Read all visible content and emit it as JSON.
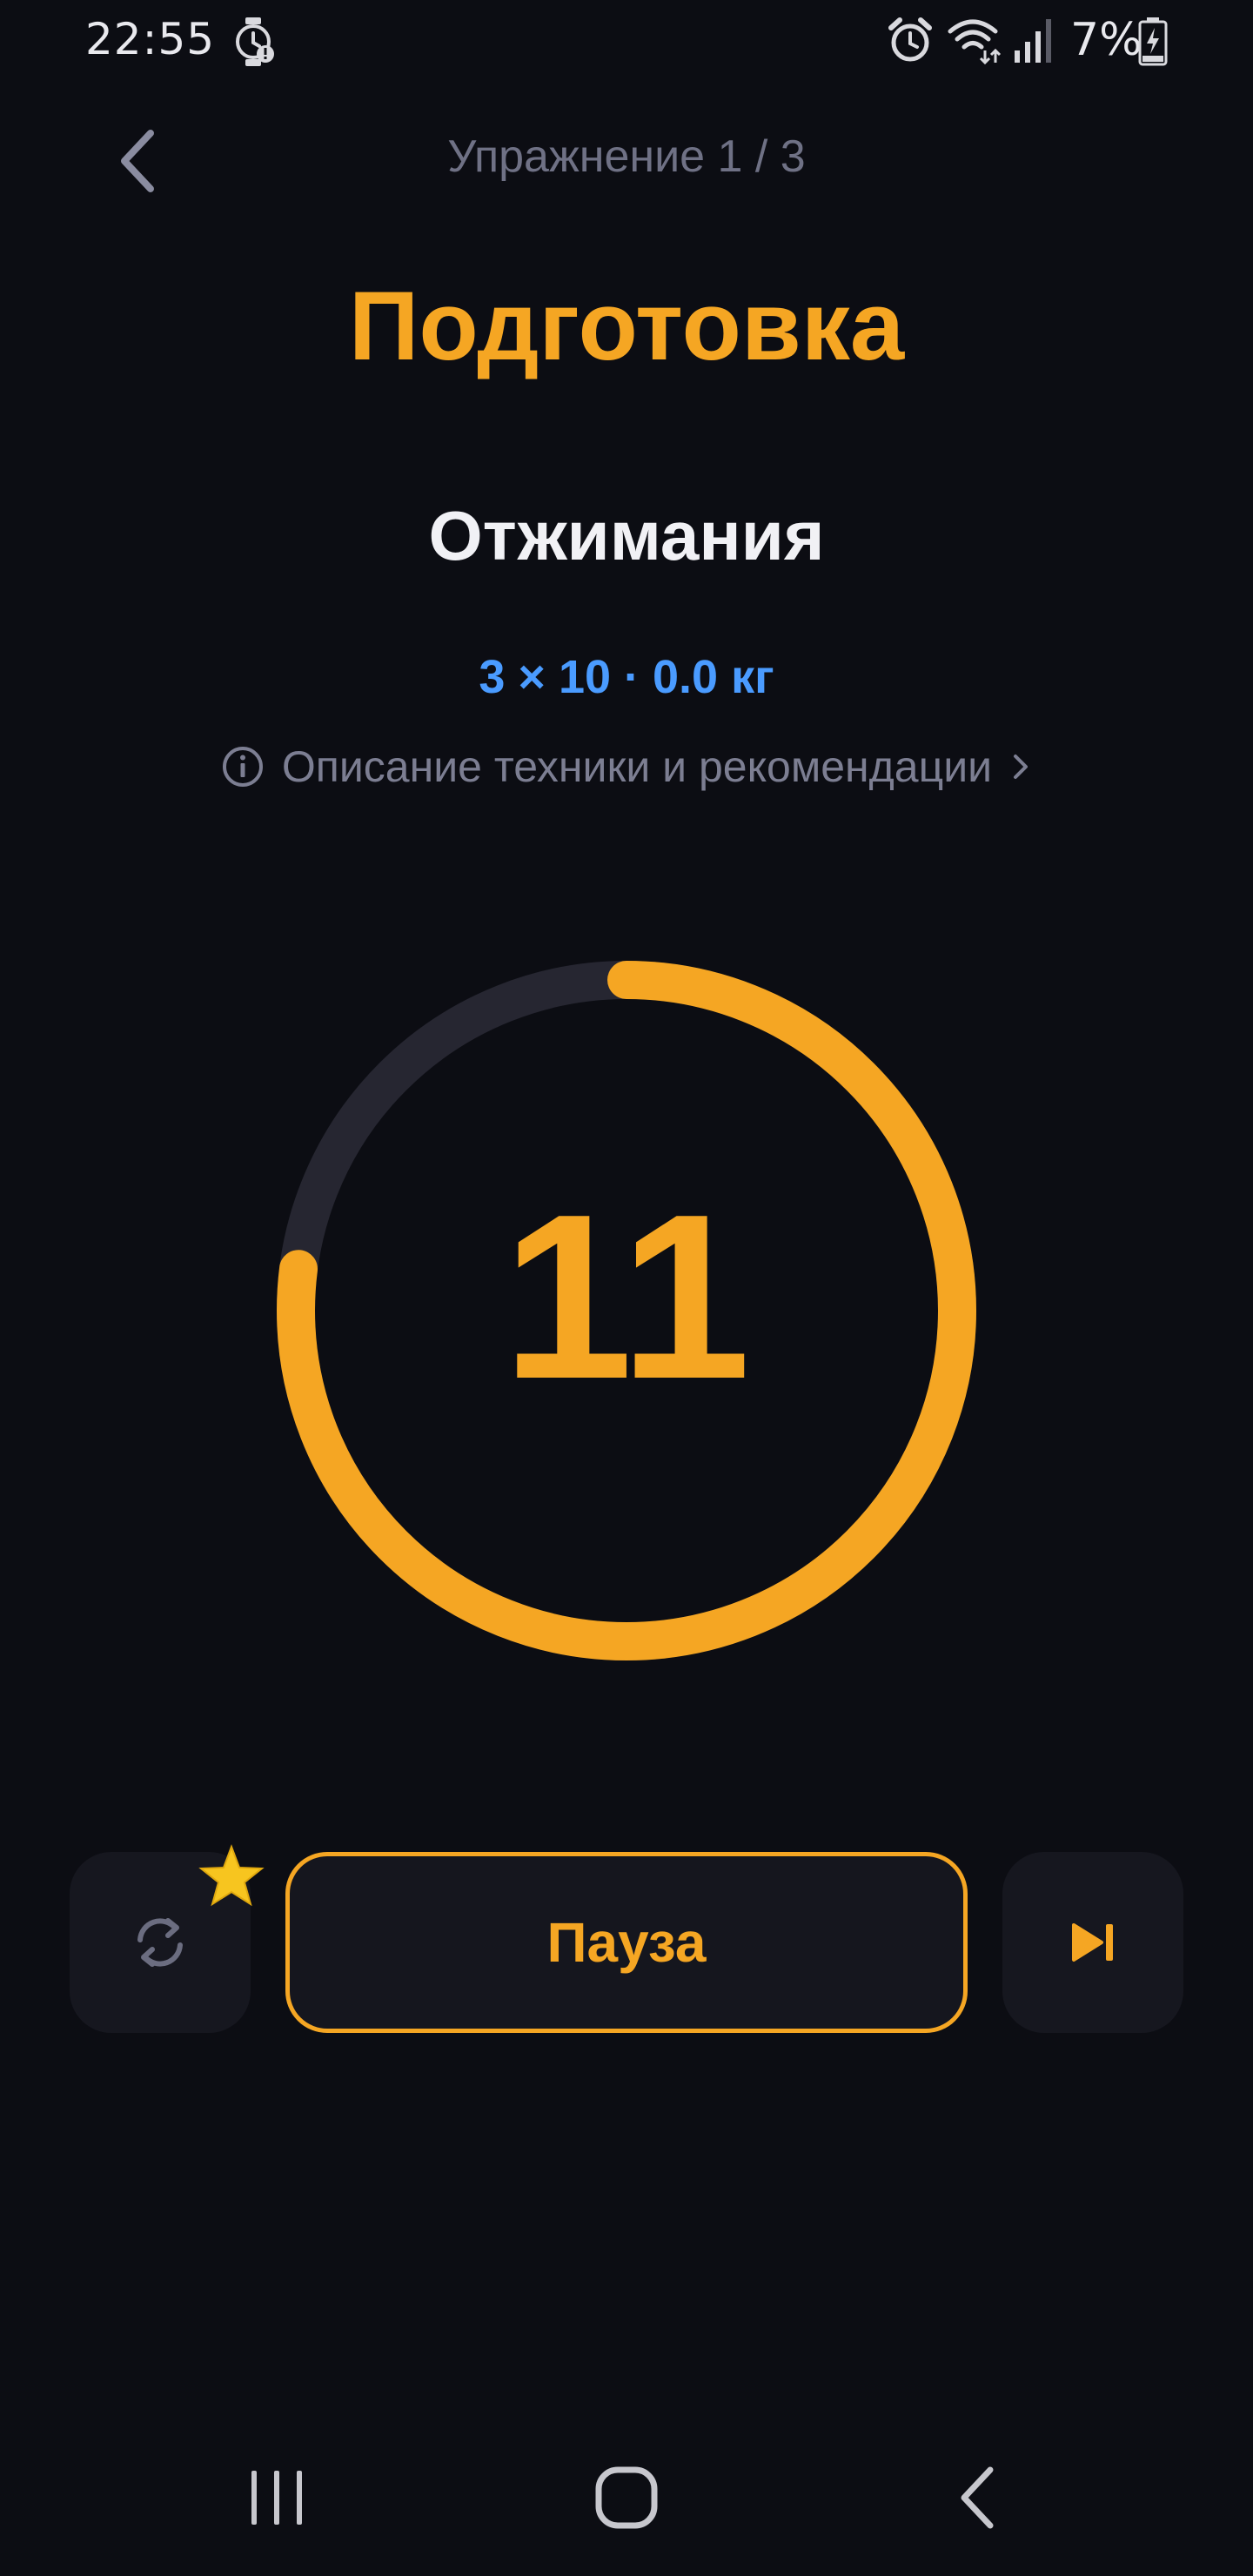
{
  "status_bar": {
    "time": "22:55",
    "battery": "7%",
    "icons": [
      "watch-alert-icon",
      "alarm-icon",
      "wifi-icon",
      "signal-icon",
      "battery-charging-icon"
    ]
  },
  "header": {
    "back_icon": "chevron-left-icon",
    "exercise_counter": "Упражнение 1 / 3"
  },
  "phase": {
    "title": "Подготовка"
  },
  "exercise": {
    "name": "Отжимания",
    "params": "3 × 10 · 0.0 кг",
    "description_link": "Описание техники и рекомендации"
  },
  "timer": {
    "value": "11",
    "progress_fraction": 0.77
  },
  "controls": {
    "repeat_icon": "refresh-icon",
    "star_icon": "star-icon",
    "pause_label": "Пауза",
    "skip_icon": "skip-next-icon"
  },
  "nav_bar": {
    "icons": [
      "recent-apps-icon",
      "home-icon",
      "back-icon"
    ]
  },
  "colors": {
    "background": "#0c0d13",
    "accent": "#f5a623",
    "link_blue": "#4a9bff",
    "muted": "#6f7185",
    "ring_track": "#262631"
  }
}
